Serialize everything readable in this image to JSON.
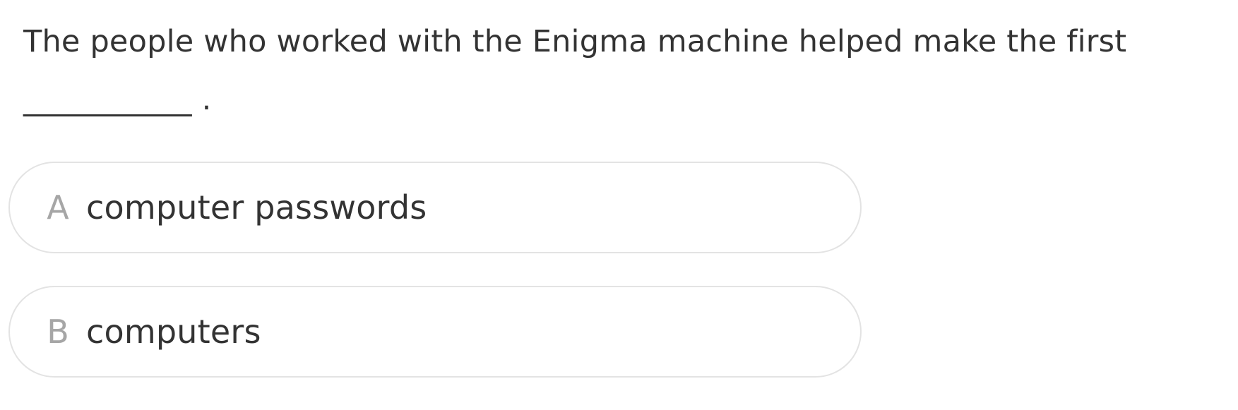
{
  "question": {
    "text_part1": "The people who worked with the Enigma machine helped make the first",
    "blank": "___________",
    "text_end": " ."
  },
  "options": [
    {
      "letter": "A",
      "text": "computer passwords"
    },
    {
      "letter": "B",
      "text": "computers"
    }
  ],
  "colors": {
    "text": "#333333",
    "letter": "#a6a6a6",
    "border": "#e3e3e3",
    "background": "#ffffff"
  }
}
